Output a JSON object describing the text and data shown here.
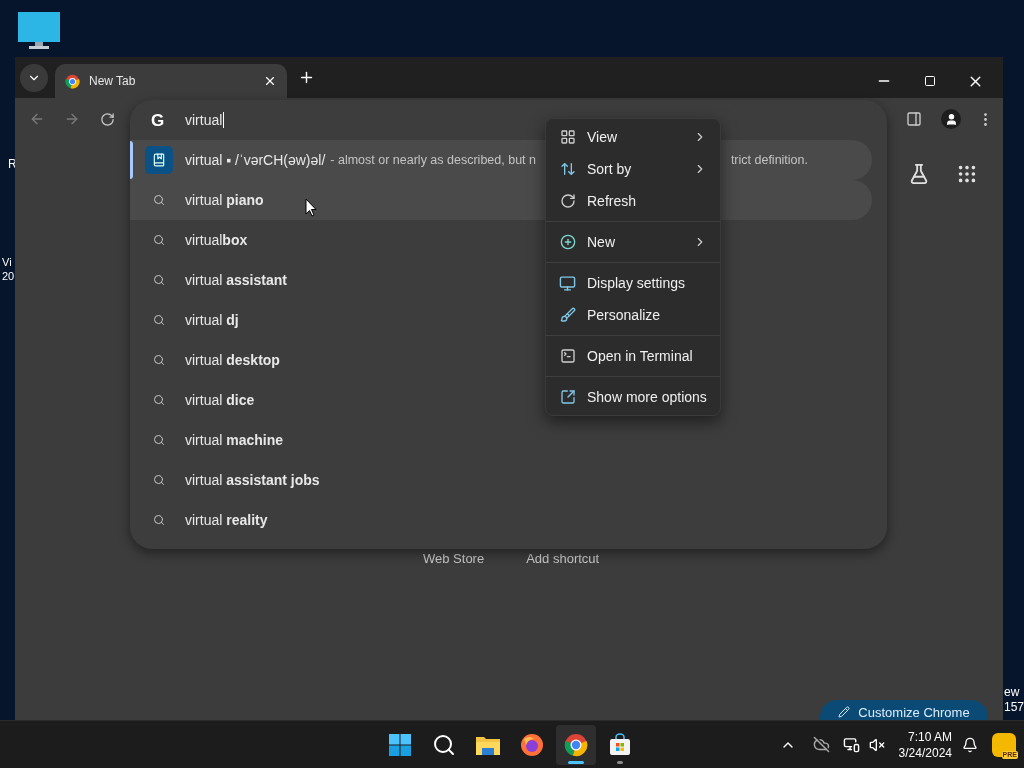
{
  "desktop": {
    "left_edge_texts": [
      "R",
      "Vi",
      "20"
    ],
    "right_edge_texts": [
      "ew",
      "157"
    ]
  },
  "browser": {
    "tabs": [
      {
        "title": "New Tab",
        "selected": true
      }
    ],
    "omnibox": {
      "engine_mark": "G",
      "value": "virtual"
    },
    "suggestions": [
      {
        "kind": "definition",
        "word": "virtual ▪ /ˈvərCH(əw)əl/",
        "definition": "- almost or nearly as described, but n",
        "definition_tail": "trict definition.",
        "selected": true,
        "hovered": false
      },
      {
        "kind": "search",
        "text": "virtual **piano**",
        "selected": false,
        "hovered": true
      },
      {
        "kind": "search",
        "text": "virtual**box**",
        "selected": false,
        "hovered": false
      },
      {
        "kind": "search",
        "text": "virtual **assistant**",
        "selected": false,
        "hovered": false
      },
      {
        "kind": "search",
        "text": "virtual **dj**",
        "selected": false,
        "hovered": false
      },
      {
        "kind": "search",
        "text": "virtual **desktop**",
        "selected": false,
        "hovered": false
      },
      {
        "kind": "search",
        "text": "virtual **dice**",
        "selected": false,
        "hovered": false
      },
      {
        "kind": "search",
        "text": "virtual **machine**",
        "selected": false,
        "hovered": false
      },
      {
        "kind": "search",
        "text": "virtual **assistant jobs**",
        "selected": false,
        "hovered": false
      },
      {
        "kind": "search",
        "text": "virtual **reality**",
        "selected": false,
        "hovered": false
      }
    ],
    "ntp_links": [
      "Web Store",
      "Add shortcut"
    ],
    "customize_button": "Customize Chrome"
  },
  "context_menu": {
    "groups": [
      [
        {
          "label": "View",
          "submenu": true
        },
        {
          "label": "Sort by",
          "submenu": true
        },
        {
          "label": "Refresh",
          "submenu": false
        }
      ],
      [
        {
          "label": "New",
          "submenu": true
        }
      ],
      [
        {
          "label": "Display settings",
          "submenu": false
        },
        {
          "label": "Personalize",
          "submenu": false
        }
      ],
      [
        {
          "label": "Open in Terminal",
          "submenu": false
        }
      ],
      [
        {
          "label": "Show more options",
          "submenu": false
        }
      ]
    ]
  },
  "taskbar": {
    "apps": [
      {
        "selected": false,
        "running": false
      },
      {
        "selected": false,
        "running": false
      },
      {
        "selected": false,
        "running": false
      },
      {
        "selected": false,
        "running": false
      },
      {
        "selected": true,
        "running": true
      },
      {
        "selected": false,
        "running": true
      }
    ],
    "time": "7:10 AM",
    "date": "3/24/2024",
    "copilot_badge": "PRE"
  }
}
